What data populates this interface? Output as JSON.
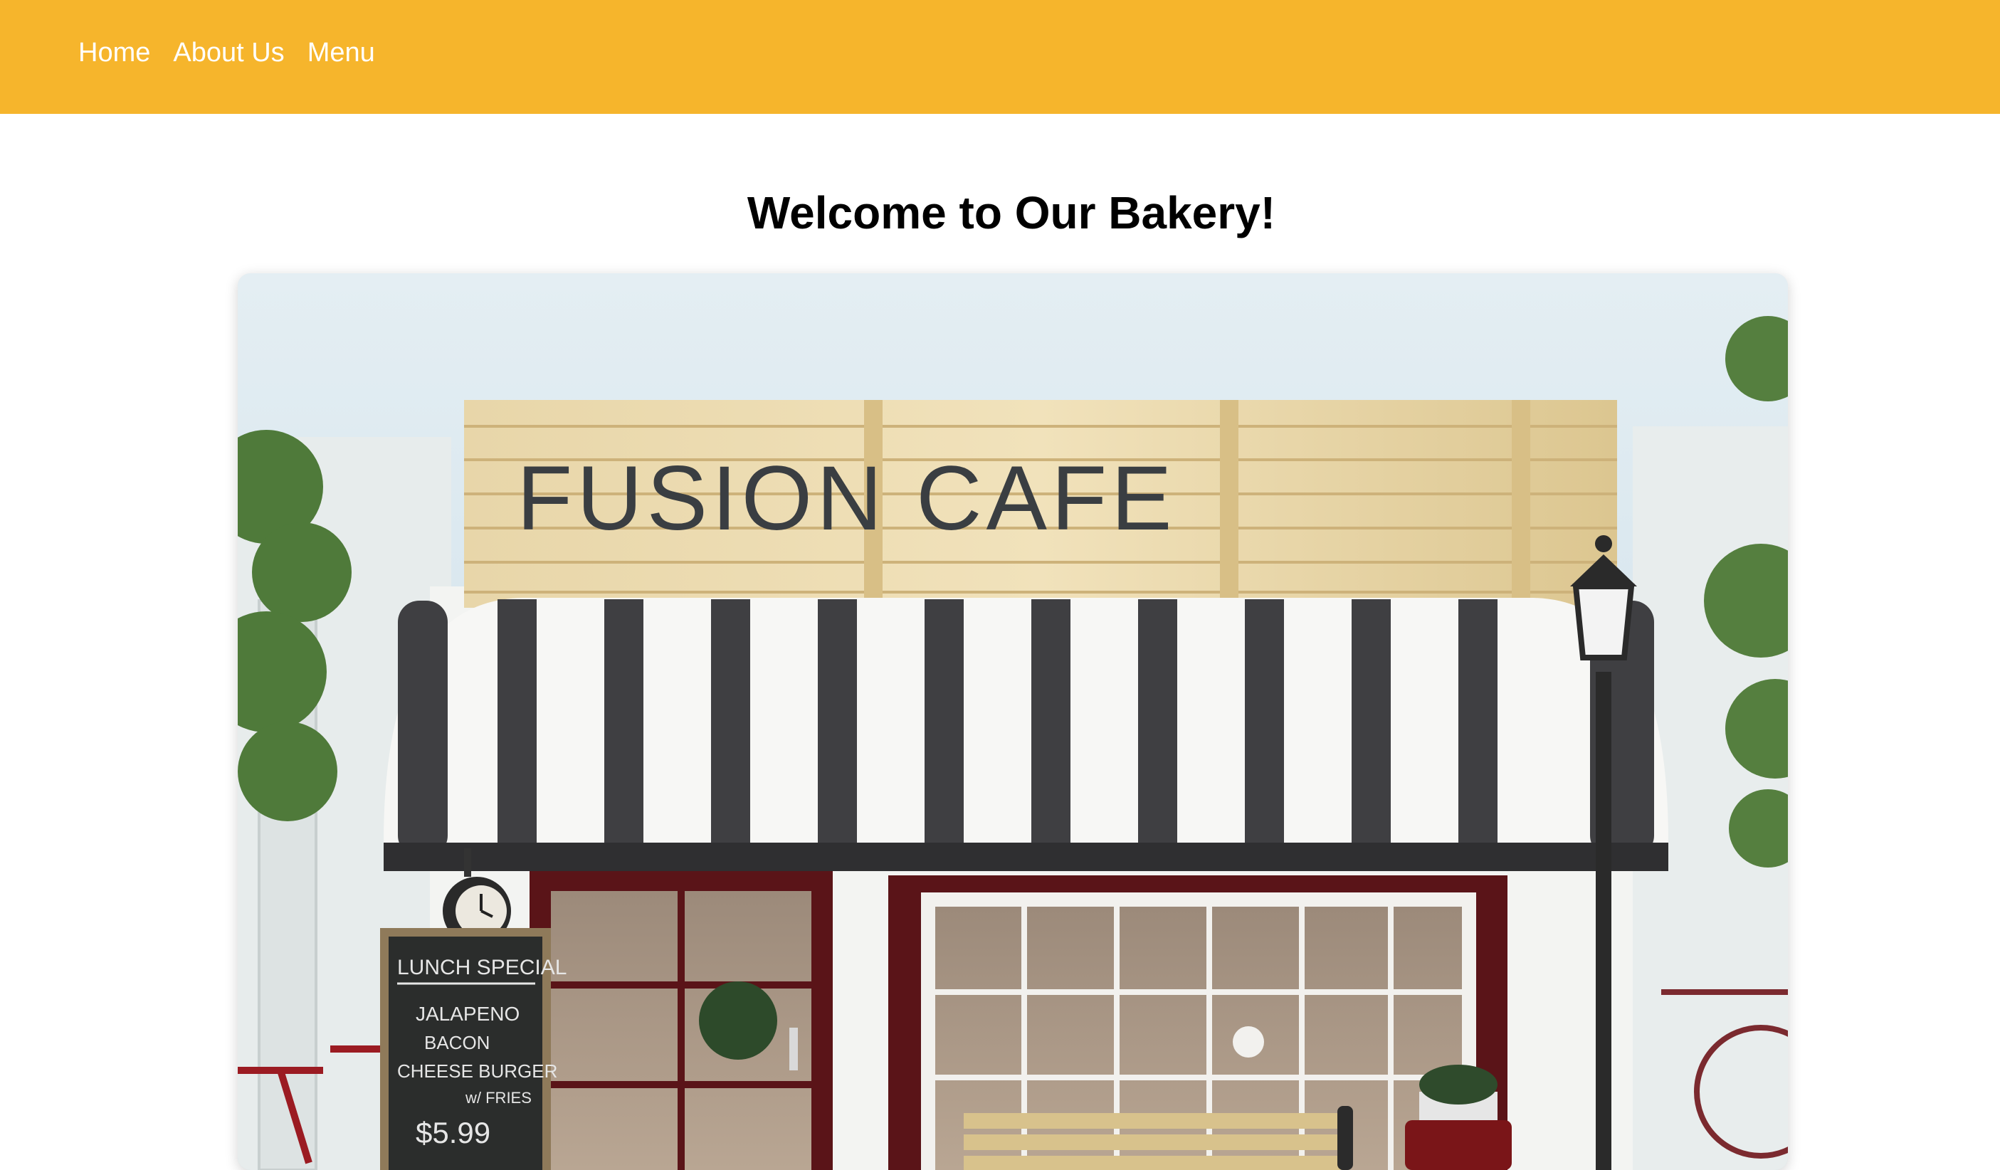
{
  "nav": {
    "items": [
      {
        "label": "Home"
      },
      {
        "label": "About Us"
      },
      {
        "label": "Menu"
      }
    ]
  },
  "main": {
    "title": "Welcome to Our Bakery!"
  },
  "hero": {
    "sign_text": "FUSION CAFE",
    "chalkboard": {
      "heading": "LUNCH SPECIAL",
      "lines": [
        "JALAPENO",
        "BACON",
        "CHEESE BURGER",
        "w/ FRIES"
      ],
      "price": "$5.99"
    }
  },
  "colors": {
    "topbar": "#f6b52c",
    "nav_text": "#ffffff",
    "title_text": "#000000"
  }
}
